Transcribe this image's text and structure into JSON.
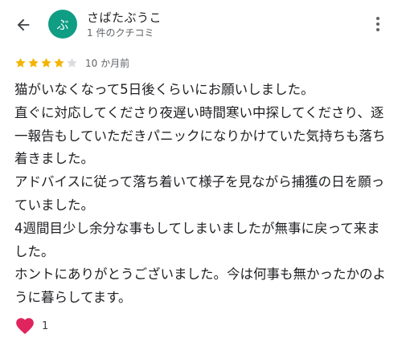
{
  "header": {
    "back_icon": "arrow-left-icon",
    "avatar_letter": "ぶ",
    "avatar_color": "#0f9d84",
    "reviewer_name": "さばたぶうこ",
    "review_count": "1 件のクチコミ",
    "more_icon": "more-vert-icon"
  },
  "review": {
    "rating": 4,
    "max_rating": 5,
    "star_color": "#f4b400",
    "empty_star_color": "#dadce0",
    "time_ago": "10 か月前",
    "text": "猫がいなくなって5日後くらいにお願いしました。\n直ぐに対応してくださり夜遅い時間寒い中探してくださり、逐一報告もしていただきパニックになりかけていた気持ちも落ち着きました。\nアドバイスに従って落ち着いて様子を見ながら捕獲の日を願っていました。\n4週間目少し余分な事もしてしまいましたが無事に戻って来ました。\nホントにありがとうございました。今は何事も無かったかのように暮らしてます。"
  },
  "reaction": {
    "icon": "red-heart-icon",
    "count": "1"
  }
}
